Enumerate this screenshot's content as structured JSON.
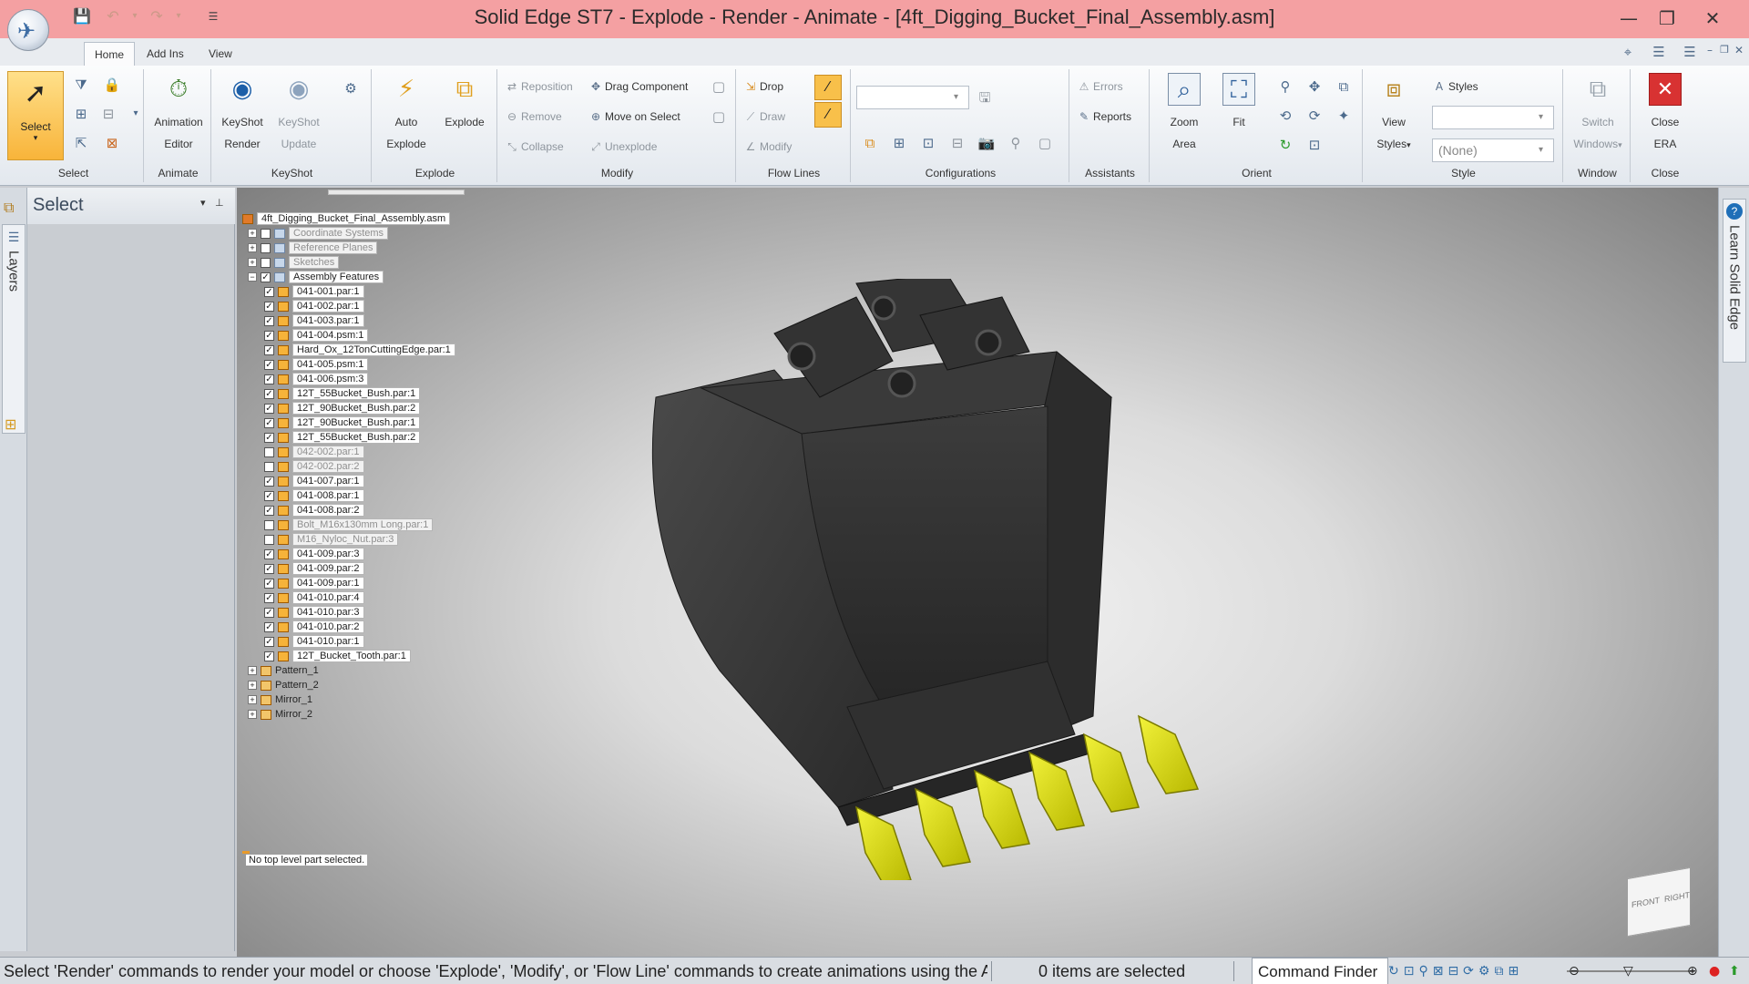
{
  "window": {
    "title": "Solid Edge ST7 - Explode - Render - Animate - [4ft_Digging_Bucket_Final_Assembly.asm]"
  },
  "tabs": [
    {
      "label": "Home",
      "active": true
    },
    {
      "label": "Add Ins",
      "active": false
    },
    {
      "label": "View",
      "active": false
    }
  ],
  "ribbon": {
    "select": {
      "label": "Select",
      "group": "Select"
    },
    "animate": {
      "line1": "Animation",
      "line2": "Editor",
      "group": "Animate"
    },
    "keyshot": {
      "render_1": "KeyShot",
      "render_2": "Render",
      "update_1": "KeyShot",
      "update_2": "Update",
      "group": "KeyShot"
    },
    "explode": {
      "auto_1": "Auto",
      "auto_2": "Explode",
      "explode": "Explode",
      "group": "Explode"
    },
    "modify": {
      "reposition": "Reposition",
      "remove": "Remove",
      "collapse": "Collapse",
      "drag_component": "Drag Component",
      "move_on_select": "Move on Select",
      "unexplode": "Unexplode",
      "group": "Modify"
    },
    "flow_lines": {
      "drop": "Drop",
      "draw": "Draw",
      "modify": "Modify",
      "group": "Flow Lines"
    },
    "configurations": {
      "group": "Configurations"
    },
    "assistants": {
      "errors": "Errors",
      "reports": "Reports",
      "group": "Assistants"
    },
    "orient": {
      "zoom_1": "Zoom",
      "zoom_2": "Area",
      "fit": "Fit",
      "group": "Orient"
    },
    "style": {
      "view_1": "View",
      "view_2": "Styles",
      "styles": "Styles",
      "none": "(None)",
      "group": "Style"
    },
    "window_group": {
      "switch_1": "Switch",
      "switch_2": "Windows",
      "group": "Window"
    },
    "close_group": {
      "close_1": "Close",
      "close_2": "ERA",
      "group": "Close"
    }
  },
  "panel": {
    "title": "Select",
    "layers_label": "Layers",
    "learn_label": "Learn Solid Edge"
  },
  "tree": {
    "root": "4ft_Digging_Bucket_Final_Assembly.asm",
    "top_nodes": [
      {
        "label": "Coordinate Systems",
        "grey": true
      },
      {
        "label": "Reference Planes",
        "grey": true
      },
      {
        "label": "Sketches",
        "grey": true
      },
      {
        "label": "Assembly Features",
        "grey": false
      }
    ],
    "parts": [
      {
        "label": "041-001.par:1",
        "checked": true,
        "grey": false
      },
      {
        "label": "041-002.par:1",
        "checked": true,
        "grey": false
      },
      {
        "label": "041-003.par:1",
        "checked": true,
        "grey": false
      },
      {
        "label": "041-004.psm:1",
        "checked": true,
        "grey": false
      },
      {
        "label": "Hard_Ox_12TonCuttingEdge.par:1",
        "checked": true,
        "grey": false
      },
      {
        "label": "041-005.psm:1",
        "checked": true,
        "grey": false
      },
      {
        "label": "041-006.psm:3",
        "checked": true,
        "grey": false
      },
      {
        "label": "12T_55Bucket_Bush.par:1",
        "checked": true,
        "grey": false
      },
      {
        "label": "12T_90Bucket_Bush.par:2",
        "checked": true,
        "grey": false
      },
      {
        "label": "12T_90Bucket_Bush.par:1",
        "checked": true,
        "grey": false
      },
      {
        "label": "12T_55Bucket_Bush.par:2",
        "checked": true,
        "grey": false
      },
      {
        "label": "042-002.par:1",
        "checked": false,
        "grey": true
      },
      {
        "label": "042-002.par:2",
        "checked": false,
        "grey": true
      },
      {
        "label": "041-007.par:1",
        "checked": true,
        "grey": false
      },
      {
        "label": "041-008.par:1",
        "checked": true,
        "grey": false
      },
      {
        "label": "041-008.par:2",
        "checked": true,
        "grey": false
      },
      {
        "label": "Bolt_M16x130mm Long.par:1",
        "checked": false,
        "grey": true
      },
      {
        "label": "M16_Nyloc_Nut.par:3",
        "checked": false,
        "grey": true
      },
      {
        "label": "041-009.par:3",
        "checked": true,
        "grey": false
      },
      {
        "label": "041-009.par:2",
        "checked": true,
        "grey": false
      },
      {
        "label": "041-009.par:1",
        "checked": true,
        "grey": false
      },
      {
        "label": "041-010.par:4",
        "checked": true,
        "grey": false
      },
      {
        "label": "041-010.par:3",
        "checked": true,
        "grey": false
      },
      {
        "label": "041-010.par:2",
        "checked": true,
        "grey": false
      },
      {
        "label": "041-010.par:1",
        "checked": true,
        "grey": false
      },
      {
        "label": "12T_Bucket_Tooth.par:1",
        "checked": true,
        "grey": false
      }
    ],
    "features": [
      {
        "label": "Pattern_1"
      },
      {
        "label": "Pattern_2"
      },
      {
        "label": "Mirror_1"
      },
      {
        "label": "Mirror_2"
      }
    ],
    "status": "No top level part selected."
  },
  "viewcube": {
    "front": "FRONT",
    "right": "RIGHT"
  },
  "statusbar": {
    "prompt": "Select 'Render' commands to render your model or choose 'Explode', 'Modify', or 'Flow Line' commands to create animations using the A",
    "count": "0 items are selected",
    "finder": "Command Finder"
  }
}
